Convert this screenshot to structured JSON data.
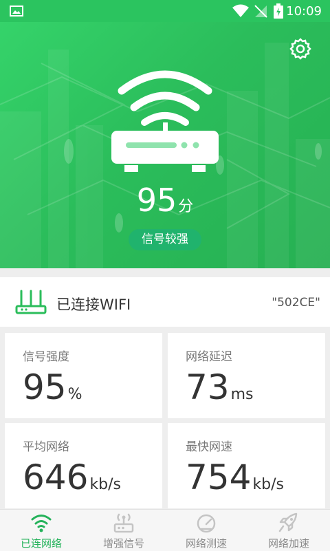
{
  "status_bar": {
    "time": "10:09"
  },
  "hero": {
    "score": "95",
    "score_unit": "分",
    "signal_badge": "信号较强",
    "colors": {
      "primary": "#2bc45f",
      "badge": "#20b36d"
    }
  },
  "wifi": {
    "label": "已连接WIFI",
    "ssid": "\"502CE\""
  },
  "stats": [
    {
      "label": "信号强度",
      "value": "95",
      "unit": "%"
    },
    {
      "label": "网络延迟",
      "value": "73",
      "unit": "ms"
    },
    {
      "label": "平均网络",
      "value": "646",
      "unit": "kb/s"
    },
    {
      "label": "最快网速",
      "value": "754",
      "unit": "kb/s"
    }
  ],
  "tabs": [
    {
      "label": "已连网络",
      "active": true
    },
    {
      "label": "增强信号",
      "active": false
    },
    {
      "label": "网络测速",
      "active": false
    },
    {
      "label": "网络加速",
      "active": false
    }
  ],
  "icons": [
    "image-icon",
    "wifi-signal-icon",
    "no-sim-icon",
    "battery-icon",
    "gear-icon",
    "router-icon",
    "wifi-router-icon",
    "wifi-tab-icon",
    "booster-tab-icon",
    "speedometer-tab-icon",
    "rocket-tab-icon"
  ]
}
